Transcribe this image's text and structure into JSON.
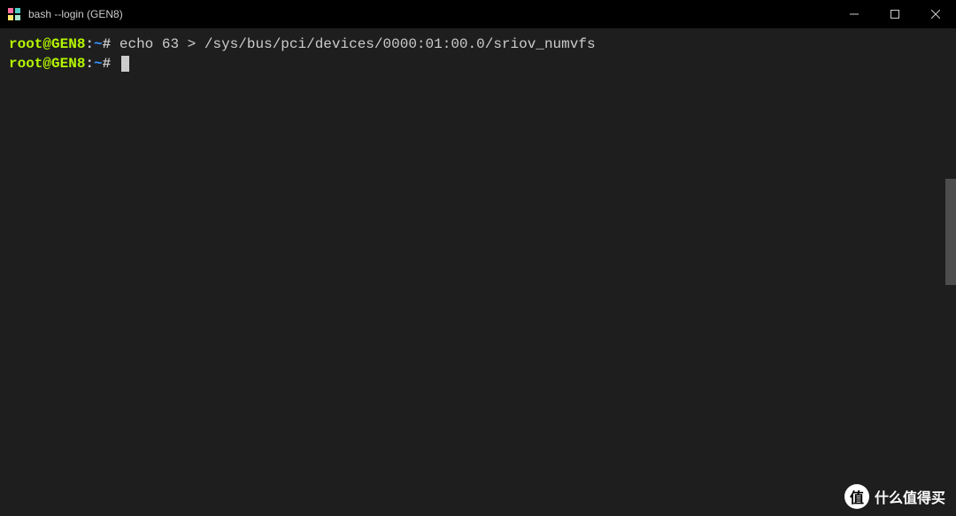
{
  "window": {
    "title": "bash --login (GEN8)"
  },
  "terminal": {
    "lines": [
      {
        "user": "root@GEN8",
        "separator": ":",
        "path": "~",
        "symbol": "#",
        "command": "echo 63 > /sys/bus/pci/devices/0000:01:00.0/sriov_numvfs"
      },
      {
        "user": "root@GEN8",
        "separator": ":",
        "path": "~",
        "symbol": "#",
        "command": ""
      }
    ]
  },
  "watermark": {
    "badge": "值",
    "text": "什么值得买"
  },
  "colors": {
    "background": "#1e1e1e",
    "titlebar": "#000000",
    "prompt_user": "#b5f700",
    "prompt_path": "#3794ff",
    "text": "#cccccc"
  }
}
